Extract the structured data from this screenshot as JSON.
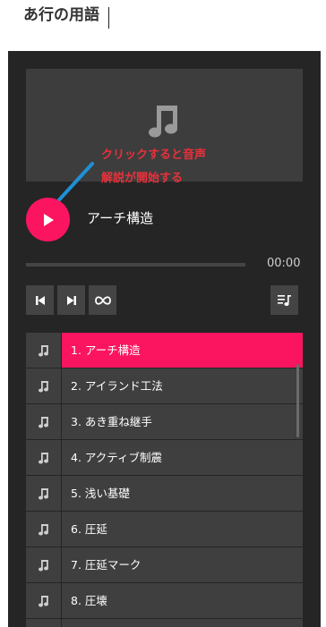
{
  "page": {
    "title": "あ行の用語"
  },
  "player": {
    "now_playing": "アーチ構造",
    "time": "00:00",
    "progress": 0,
    "accent_color": "#fb1560",
    "icons": {
      "artwork": "music-note-icon",
      "play": "play-icon",
      "prev": "skip-previous-icon",
      "next": "skip-next-icon",
      "loop": "loop-icon",
      "playlist": "playlist-icon",
      "track": "music-note-icon"
    }
  },
  "annotation": {
    "line1": "クリックすると音声",
    "line2": "解説が開始する",
    "color": "#e8313b",
    "arrow_color": "#1e90d6"
  },
  "playlist": {
    "tracks": [
      {
        "label": "1. アーチ構造",
        "active": true
      },
      {
        "label": "2. アイランド工法",
        "active": false
      },
      {
        "label": "3. あき重ね継手",
        "active": false
      },
      {
        "label": "4. アクティブ制震",
        "active": false
      },
      {
        "label": "5. 浅い基礎",
        "active": false
      },
      {
        "label": "6. 圧延",
        "active": false
      },
      {
        "label": "7. 圧延マーク",
        "active": false
      },
      {
        "label": "8. 圧壊",
        "active": false
      },
      {
        "label": "",
        "active": false
      }
    ]
  }
}
